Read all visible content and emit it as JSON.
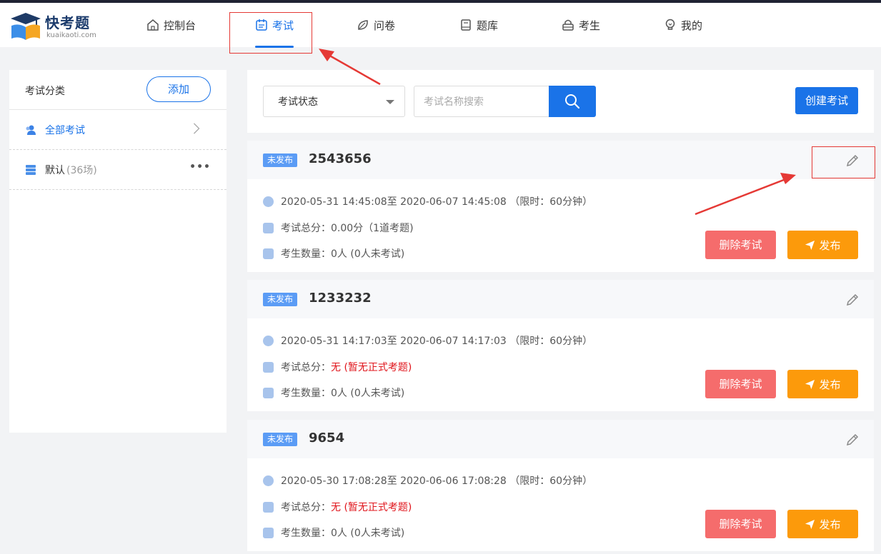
{
  "app": {
    "logo_title": "快考题",
    "logo_sub": "kuaikaoti.com"
  },
  "nav": {
    "items": [
      {
        "label": "控制台",
        "icon": "home-icon"
      },
      {
        "label": "考试",
        "icon": "calendar-icon",
        "active": true
      },
      {
        "label": "问卷",
        "icon": "leaf-icon"
      },
      {
        "label": "题库",
        "icon": "book-icon"
      },
      {
        "label": "考生",
        "icon": "lock-icon"
      },
      {
        "label": "我的",
        "icon": "bulb-icon"
      }
    ]
  },
  "sidebar": {
    "title": "考试分类",
    "add_label": "添加",
    "items": [
      {
        "label": "全部考试",
        "count": "",
        "active": true
      },
      {
        "label": "默认",
        "count": "(36场)",
        "menu": "•••"
      }
    ]
  },
  "filter": {
    "status_label": "考试状态",
    "search_placeholder": "考试名称搜索",
    "create_label": "创建考试"
  },
  "exams": [
    {
      "status": "未发布",
      "name": "2543656",
      "time": "2020-05-31 14:45:08至 2020-06-07 14:45:08 （限时：60分钟）",
      "score_label": "考试总分：",
      "score_value": "0.00分（1道考题)",
      "score_red": false,
      "count_label": "考生数量：",
      "count_value": "0人 (0人未考试)",
      "delete_label": "删除考试",
      "publish_label": "发布"
    },
    {
      "status": "未发布",
      "name": "1233232",
      "time": "2020-05-31 14:17:03至 2020-06-07 14:17:03 （限时：60分钟）",
      "score_label": "考试总分：",
      "score_value": "无 (暂无正式考题)",
      "score_red": true,
      "count_label": "考生数量：",
      "count_value": "0人 (0人未考试)",
      "delete_label": "删除考试",
      "publish_label": "发布"
    },
    {
      "status": "未发布",
      "name": "9654",
      "time": "2020-05-30 17:08:28至 2020-06-06 17:08:28 （限时：60分钟）",
      "score_label": "考试总分：",
      "score_value": "无 (暂无正式考题)",
      "score_red": true,
      "count_label": "考生数量：",
      "count_value": "0人 (0人未考试)",
      "delete_label": "删除考试",
      "publish_label": "发布"
    }
  ],
  "colors": {
    "primary": "#1a73e8",
    "delete": "#f56c6c",
    "publish": "#fc9a0b",
    "annotation": "#e53935"
  }
}
